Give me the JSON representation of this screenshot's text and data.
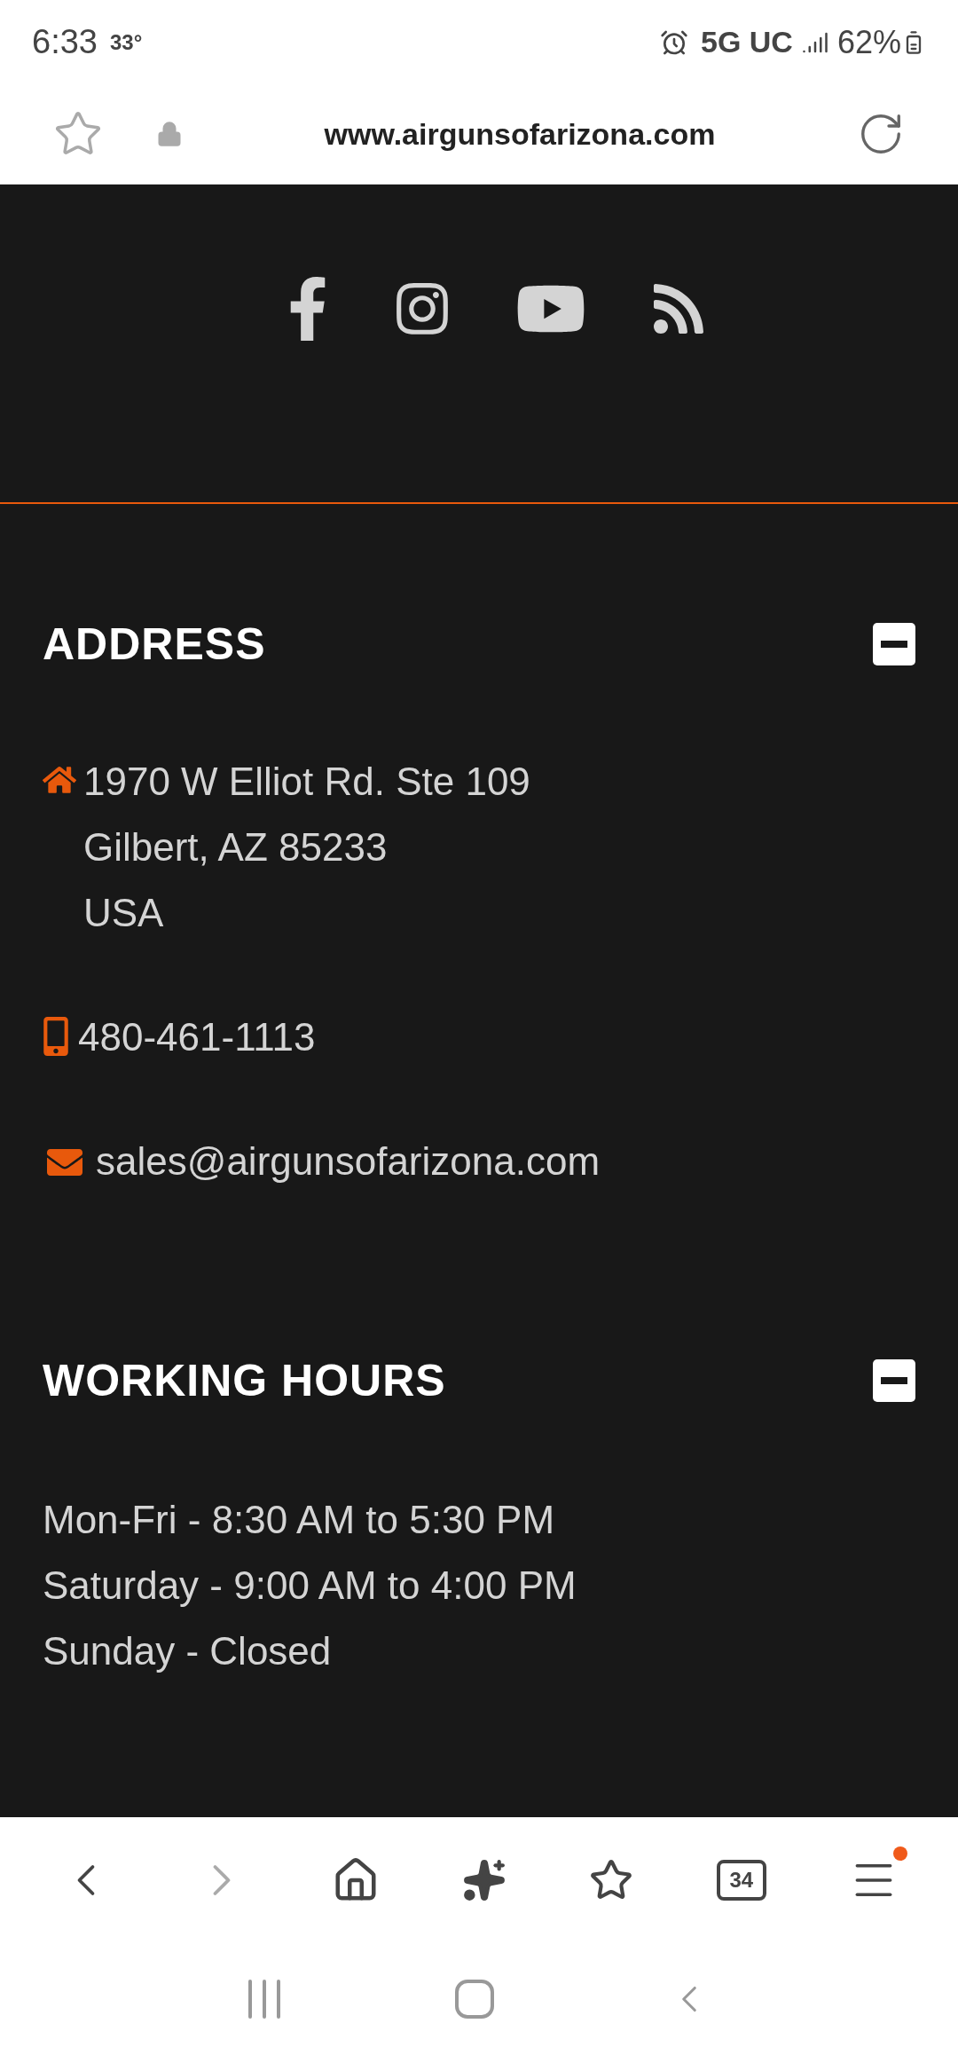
{
  "status_bar": {
    "time": "6:33",
    "temperature": "33°",
    "network": "5G UC",
    "battery": "62%"
  },
  "url_bar": {
    "url": "www.airgunsofarizona.com"
  },
  "sections": [
    {
      "title": "ADDRESS",
      "expanded": true,
      "entries": [
        {
          "kind": "address",
          "lines": [
            "1970 W Elliot Rd. Ste 109",
            "Gilbert, AZ 85233",
            "USA"
          ]
        },
        {
          "kind": "phone",
          "lines": [
            "480-461-1113"
          ]
        },
        {
          "kind": "email",
          "lines": [
            "sales@airgunsofarizona.com"
          ]
        }
      ]
    },
    {
      "title": "WORKING HOURS",
      "expanded": true,
      "entries": [
        {
          "kind": "hours",
          "lines": [
            "Mon-Fri - 8:30 AM to 5:30 PM",
            "Saturday - 9:00 AM to 4:00 PM",
            "Sunday - Closed"
          ]
        }
      ]
    }
  ],
  "bottom_nav": {
    "tab_count": "34",
    "menu_notification": true
  }
}
